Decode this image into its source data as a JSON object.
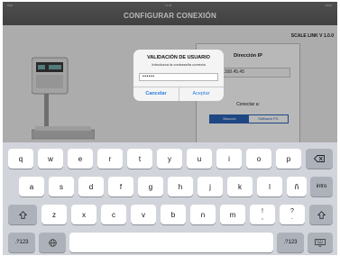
{
  "status_bar": {
    "left": "iPad",
    "center": "11:49",
    "right": "100%"
  },
  "nav": {
    "title": "CONFIGURAR CONEXIÓN"
  },
  "brand": "SCALE LINK V 1.0.0",
  "panel": {
    "ip_label": "Dirección IP",
    "ip_value": "192.168.45.45",
    "connect_label": "Conectar a:",
    "seg_options": [
      "Báscula",
      "Software PC"
    ]
  },
  "alert": {
    "title": "VALIDACIÓN DE USUARIO",
    "message": "Introduzca la contraseña correcta",
    "password_mask": "••••••",
    "cancel_label": "Cancelar",
    "accept_label": "Aceptar"
  },
  "keyboard": {
    "row1": [
      "q",
      "w",
      "e",
      "r",
      "t",
      "y",
      "u",
      "i",
      "o",
      "p"
    ],
    "row2": [
      "a",
      "s",
      "d",
      "f",
      "g",
      "h",
      "j",
      "k",
      "l",
      "ñ"
    ],
    "row3": [
      "z",
      "x",
      "c",
      "v",
      "b",
      "n",
      "m"
    ],
    "sym1_top": "!",
    "sym1_bottom": ",",
    "sym2_top": "?",
    "sym2_bottom": ".",
    "return_label": "intro",
    "num_label": ".?123",
    "icons": {
      "delete": "backspace-icon",
      "shift": "shift-icon",
      "globe": "globe-icon",
      "dismiss": "keyboard-dismiss-icon"
    }
  },
  "colors": {
    "accent": "#2a7ae2",
    "segment": "#2a63b8",
    "nav": "#626262"
  }
}
